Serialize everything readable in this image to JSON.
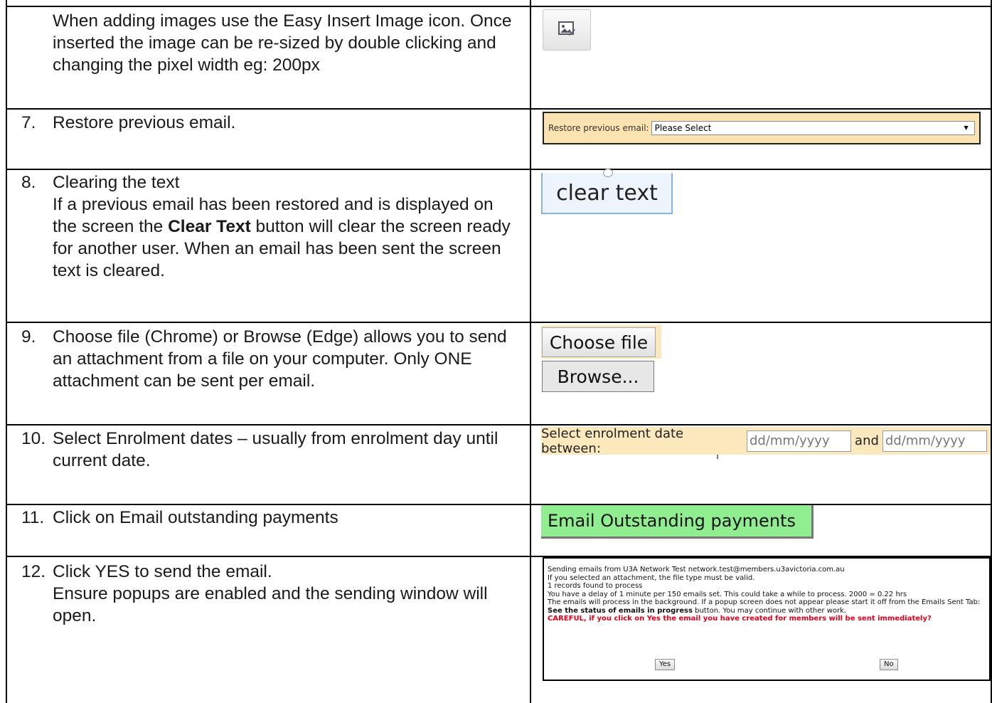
{
  "rows": {
    "r6": {
      "text": "When adding images use the Easy Insert Image icon. Once inserted the image can be re-sized by double clicking and changing the pixel width eg: 200px"
    },
    "r7": {
      "num": "7.",
      "text": "Restore previous email."
    },
    "r8": {
      "num": "8.",
      "line1": "Clearing the text",
      "pre": "If a previous email has been restored and is displayed on the screen the ",
      "bold": "Clear Text",
      "post": " button will clear the screen ready for another user.  When an email has been sent the screen text is cleared."
    },
    "r9": {
      "num": "9.",
      "text": "Choose file (Chrome) or Browse (Edge) allows you to send an attachment from a file on your computer. Only ONE attachment can be sent per email."
    },
    "r10": {
      "num": "10.",
      "text": "Select Enrolment dates – usually from enrolment day until current date."
    },
    "r11": {
      "num": "11.",
      "text": "Click on Email outstanding payments"
    },
    "r12": {
      "num": "12.",
      "line1": "Click YES to send the email.",
      "line2": "Ensure popups are enabled and the sending window will open."
    }
  },
  "icons": {
    "insert_image": "insert-image-icon",
    "dropdown": "dropdown-arrow-icon"
  },
  "restore": {
    "label": "Restore previous email:",
    "value": "Please Select"
  },
  "clear_button": "clear text",
  "choose_file_button": "Choose file",
  "browse_button": "Browse...",
  "enrolment": {
    "label": "Select enrolment date between:",
    "from_placeholder": "dd/mm/yyyy",
    "and": "and",
    "to_placeholder": "dd/mm/yyyy"
  },
  "payments_button": "Email Outstanding payments",
  "dialog": {
    "line1": "Sending emails from U3A Network Test network.test@members.u3avictoria.com.au",
    "line2": "If you selected an attachment, the file type must be valid.",
    "line3": "1 records found to process",
    "line4": "You have a delay of 1 minute per 150 emails set. This could take a while to process. 2000 = 0.22 hrs",
    "line5_pre": "The emails will process in the background. If a popup screen does not appear please start it off from the Emails Sent Tab: ",
    "line5_bold": "See the status of emails in progress",
    "line5_post": " button. You may continue with other work.",
    "warning": "CAREFUL, if you click on Yes the email you have created for members will be sent immediately?",
    "yes": "Yes",
    "no": "No"
  },
  "colors": {
    "highlight": "#fbe8bd",
    "payments_green": "#90ee90",
    "warning_red": "#e0001a",
    "clear_border": "#86b4e6"
  }
}
